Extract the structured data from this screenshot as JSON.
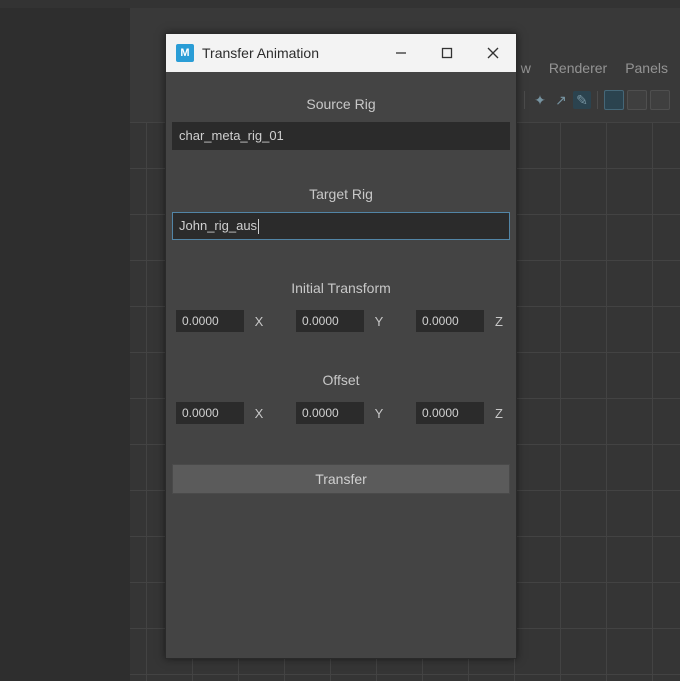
{
  "background": {
    "menus": {
      "renderer": "Renderer",
      "panels": "Panels",
      "w": "w"
    }
  },
  "dialog": {
    "title": "Transfer Animation",
    "app_icon_letter": "M",
    "source_label": "Source Rig",
    "source_value": "char_meta_rig_01",
    "target_label": "Target Rig",
    "target_value": "John_rig_aus",
    "initial_transform_label": "Initial Transform",
    "initial_transform": {
      "x": "0.0000",
      "y": "0.0000",
      "z": "0.0000"
    },
    "offset_label": "Offset",
    "offset": {
      "x": "0.0000",
      "y": "0.0000",
      "z": "0.0000"
    },
    "axis": {
      "x": "X",
      "y": "Y",
      "z": "Z"
    },
    "transfer_button": "Transfer"
  }
}
